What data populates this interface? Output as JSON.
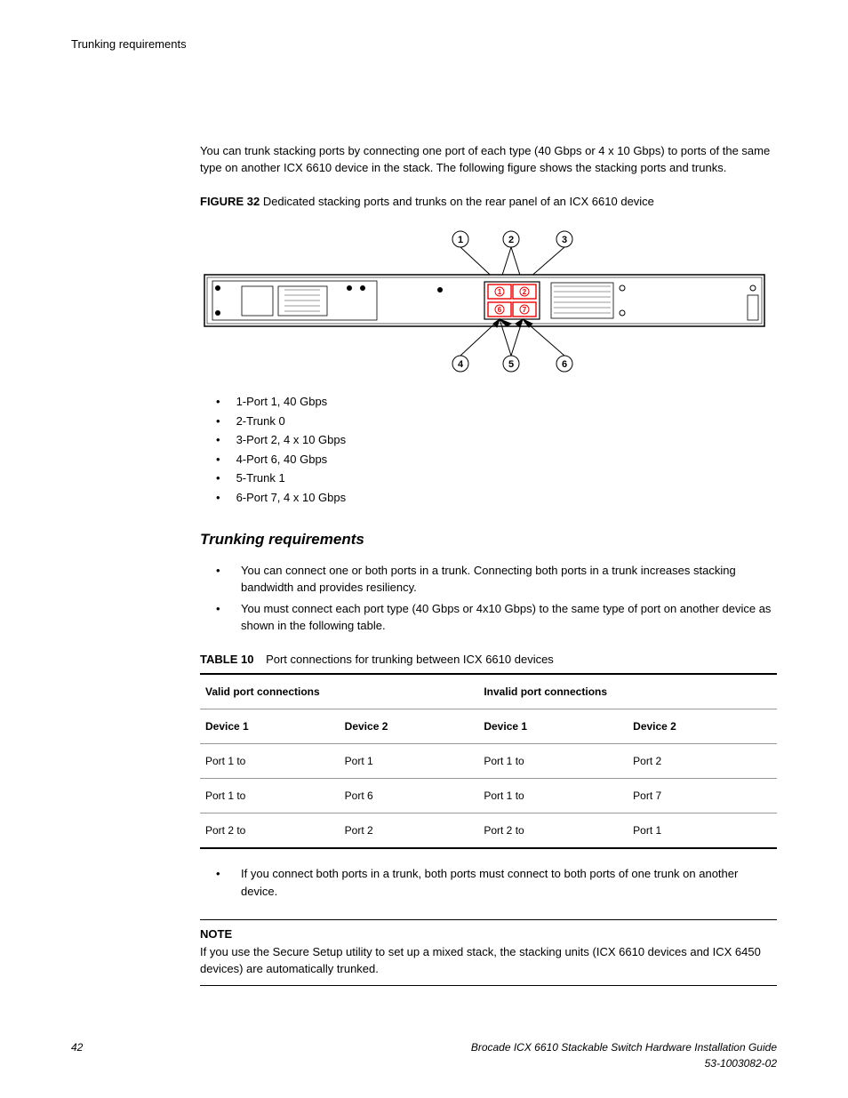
{
  "header": {
    "section": "Trunking requirements"
  },
  "intro": "You can trunk stacking ports by connecting one port of each type (40 Gbps or 4 x 10 Gbps) to ports of the same type on another ICX 6610 device in the stack. The following figure shows the stacking ports and trunks.",
  "figure": {
    "label": "FIGURE 32",
    "caption": "Dedicated stacking ports and trunks on the rear panel of an ICX 6610 device",
    "callouts": [
      "1",
      "2",
      "3",
      "4",
      "5",
      "6"
    ],
    "ports": [
      "1",
      "2",
      "6",
      "7"
    ]
  },
  "legend": [
    "1-Port 1, 40 Gbps",
    "2-Trunk 0",
    "3-Port 2, 4 x 10 Gbps",
    "4-Port 6, 40 Gbps",
    "5-Trunk 1",
    "6-Port 7, 4 x 10 Gbps"
  ],
  "section": {
    "heading": "Trunking requirements",
    "bullets": [
      "You can connect one or both ports in a trunk. Connecting both ports in a trunk increases stacking bandwidth and provides resiliency.",
      "You must connect each port type (40 Gbps or 4x10 Gbps) to the same type of port on another device as shown in the following table."
    ]
  },
  "table": {
    "label": "TABLE 10",
    "caption": "Port connections for trunking between ICX 6610 devices",
    "group_headers": [
      "Valid port connections",
      "Invalid port connections"
    ],
    "col_headers": [
      "Device 1",
      "Device 2",
      "Device 1",
      "Device 2"
    ],
    "rows": [
      [
        "Port 1 to",
        "Port 1",
        "Port 1 to",
        "Port 2"
      ],
      [
        "Port 1 to",
        "Port 6",
        "Port 1 to",
        "Port 7"
      ],
      [
        "Port 2 to",
        "Port 2",
        "Port 2 to",
        "Port 1"
      ]
    ]
  },
  "post_bullet": "If you connect both ports in a trunk, both ports must connect to both ports of one trunk on another device.",
  "note": {
    "label": "NOTE",
    "text": "If you use the Secure Setup utility to set up a mixed stack, the stacking units (ICX 6610 devices and ICX 6450 devices) are automatically trunked."
  },
  "footer": {
    "page": "42",
    "title": "Brocade ICX 6610 Stackable Switch Hardware Installation Guide",
    "docnum": "53-1003082-02"
  }
}
